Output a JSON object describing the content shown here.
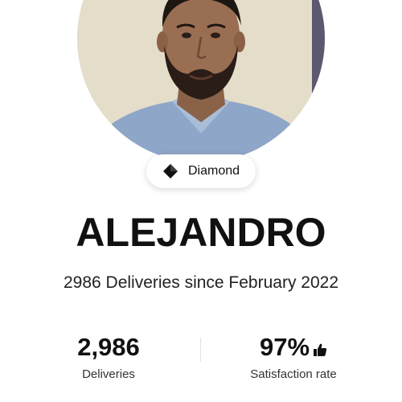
{
  "profile": {
    "badge_label": "Diamond",
    "badge_icon": "diamond-icon",
    "name": "ALEJANDRO",
    "subtitle": "2986 Deliveries since February 2022"
  },
  "stats": [
    {
      "value": "2,986",
      "label": "Deliveries"
    },
    {
      "value": "97%",
      "label": "Satisfaction rate",
      "icon": "thumbs-up-icon"
    }
  ],
  "colors": {
    "text": "#111111",
    "badge_background": "#ffffff",
    "divider": "#e2e2e2"
  }
}
